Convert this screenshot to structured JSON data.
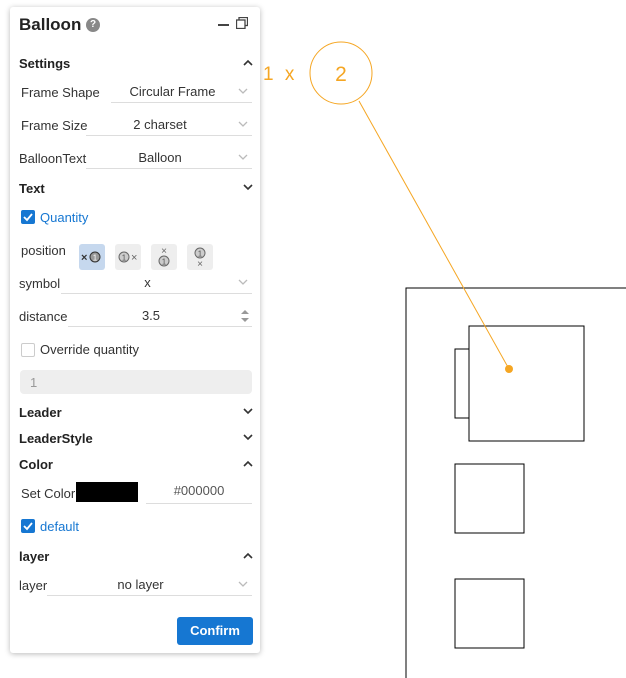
{
  "panel": {
    "title": "Balloon",
    "help_icon": "?",
    "settings": {
      "header": "Settings",
      "frame_shape": {
        "label": "Frame Shape",
        "value": "Circular Frame"
      },
      "frame_size": {
        "label": "Frame Size",
        "value": "2 charset"
      },
      "balloon_text": {
        "label": "BalloonText",
        "value": "Balloon"
      }
    },
    "text": {
      "header": "Text",
      "quantity_label": "Quantity",
      "quantity_checked": true,
      "position_label": "position",
      "symbol": {
        "label": "symbol",
        "value": "x"
      },
      "distance": {
        "label": "distance",
        "value": "3.5"
      },
      "override_label": "Override quantity",
      "override_checked": false,
      "override_value": "1"
    },
    "leader": {
      "header": "Leader"
    },
    "leader_style": {
      "header": "LeaderStyle"
    },
    "color": {
      "header": "Color",
      "set_color_label": "Set Color",
      "hex": "#000000",
      "swatch_color": "#000000",
      "default_label": "default",
      "default_checked": true
    },
    "layer": {
      "header": "layer",
      "label": "layer",
      "value": "no layer"
    },
    "confirm_label": "Confirm"
  },
  "drawing": {
    "balloon_number": "2",
    "quantity_text": "1 x",
    "accent_color": "#f5a623"
  },
  "colors": {
    "primary": "#1677d2",
    "accent": "#f5a623"
  }
}
